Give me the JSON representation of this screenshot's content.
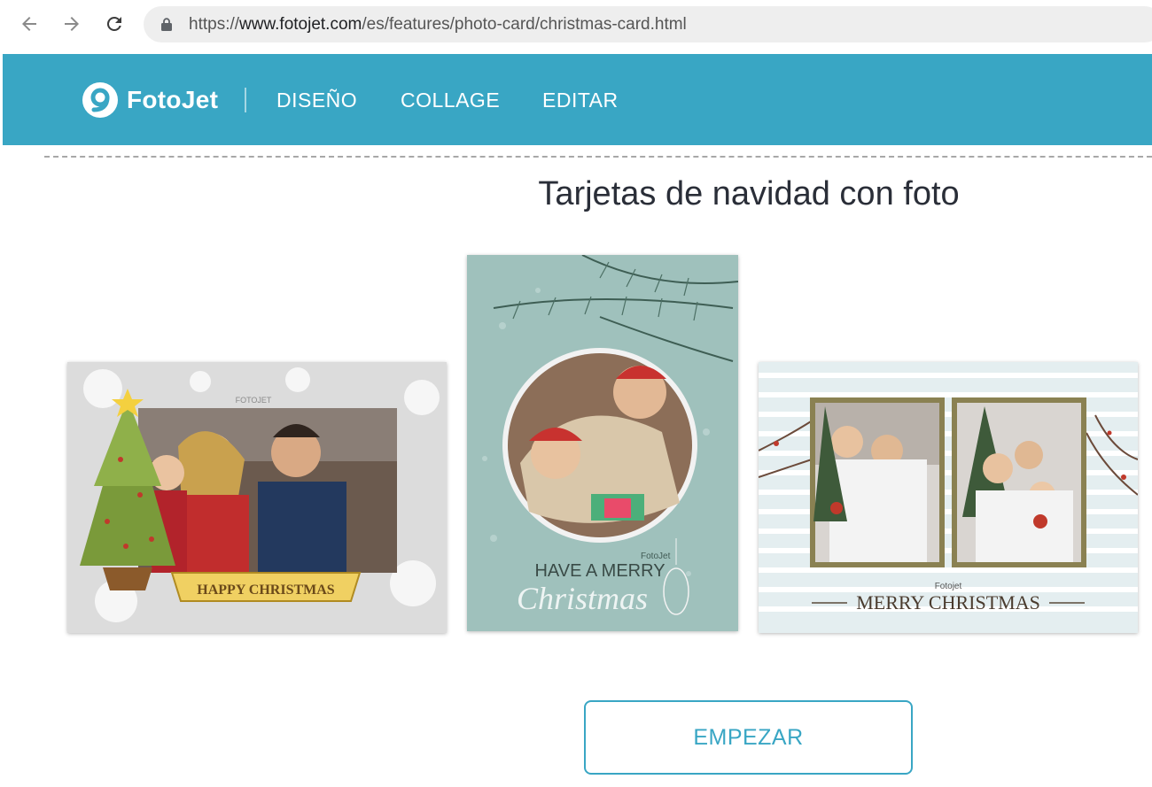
{
  "browser": {
    "url_scheme": "https://",
    "url_host": "www.fotojet.com",
    "url_path": "/es/features/photo-card/christmas-card.html"
  },
  "header": {
    "logo_text": "FotoJet",
    "nav": [
      {
        "label": "DISEÑO"
      },
      {
        "label": "COLLAGE"
      },
      {
        "label": "EDITAR"
      }
    ],
    "background_color": "#39a6c4"
  },
  "main": {
    "title": "Tarjetas de navidad con foto",
    "cards": [
      {
        "watermark": "FOTOJET",
        "banner_text": "HAPPY CHRISTMAS"
      },
      {
        "watermark": "FotoJet",
        "line1": "HAVE A MERRY",
        "line2": "Christmas"
      },
      {
        "watermark": "Fotojet",
        "caption": "MERRY CHRISTMAS"
      }
    ],
    "start_button": "EMPEZAR"
  },
  "icons": {
    "back": "arrow-left-icon",
    "forward": "arrow-right-icon",
    "reload": "reload-icon",
    "lock": "lock-icon",
    "logo": "fotojet-logo-icon"
  },
  "colors": {
    "accent": "#39a6c4",
    "title": "#2a2e38",
    "card2_bg": "#9fc1bc"
  }
}
